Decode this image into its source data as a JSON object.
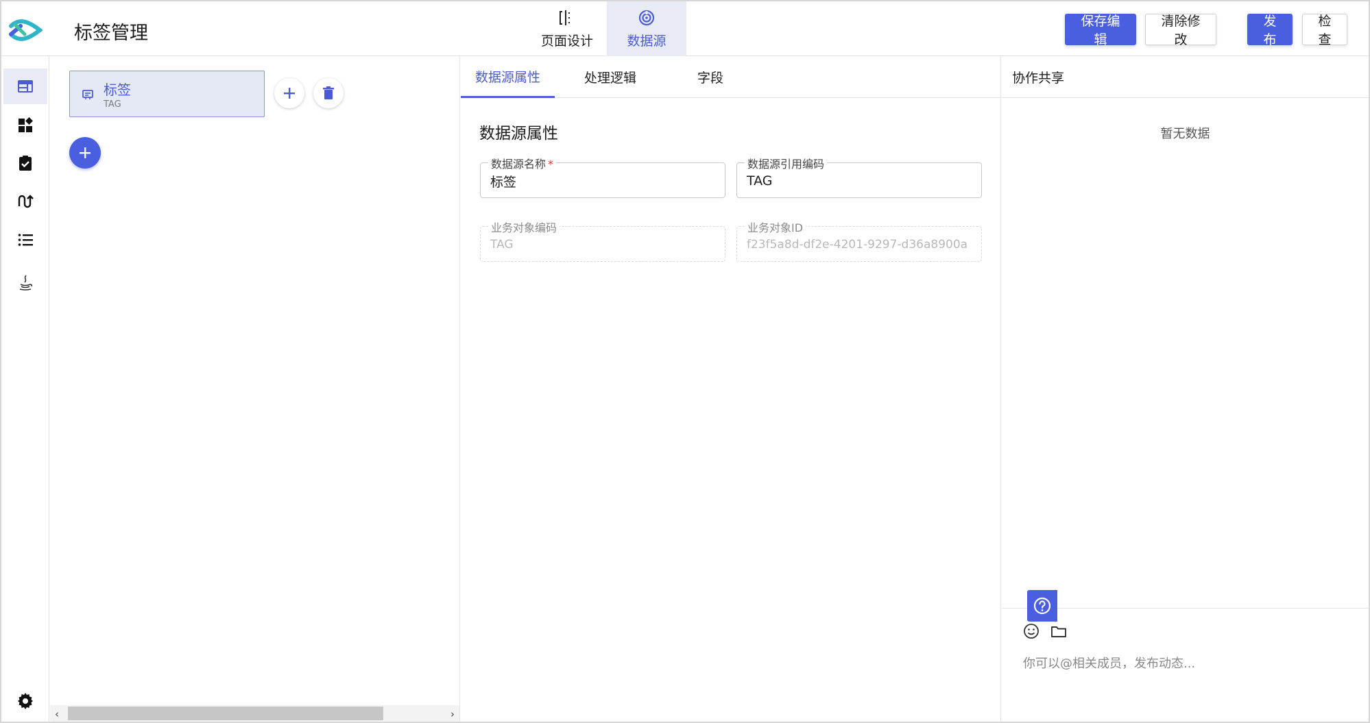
{
  "app": {
    "title": "标签管理",
    "accent_color": "#4a5fe0"
  },
  "mode_tabs": [
    {
      "label": "页面设计",
      "icon": "split-columns-icon",
      "active": false
    },
    {
      "label": "数据源",
      "icon": "target-icon",
      "active": true
    }
  ],
  "toolbar": {
    "save_label": "保存编辑",
    "clear_label": "清除修改",
    "publish_label": "发布",
    "check_label": "检查"
  },
  "rail": {
    "items": [
      {
        "icon": "web-layout-icon",
        "active": true
      },
      {
        "icon": "widgets-icon",
        "active": false
      },
      {
        "icon": "clipboard-check-icon",
        "active": false
      },
      {
        "icon": "flow-icon",
        "active": false
      },
      {
        "icon": "list-icon",
        "active": false
      },
      {
        "icon": "java-icon",
        "active": false
      }
    ],
    "bottom_icon": "gear-icon"
  },
  "datasource_list": {
    "items": [
      {
        "name": "标签",
        "code": "TAG",
        "selected": true
      }
    ]
  },
  "detail": {
    "tabs": [
      {
        "label": "数据源属性",
        "active": true
      },
      {
        "label": "处理逻辑",
        "active": false
      },
      {
        "label": "字段",
        "active": false
      }
    ],
    "section_title": "数据源属性",
    "fields": {
      "name": {
        "label": "数据源名称",
        "required_mark": "*",
        "value": "标签"
      },
      "ref_code": {
        "label": "数据源引用编码",
        "value": "TAG"
      },
      "obj_code": {
        "label": "业务对象编码",
        "value": "TAG"
      },
      "obj_id": {
        "label": "业务对象ID",
        "value": "f23f5a8d-df2e-4201-9297-d36a8900a"
      }
    }
  },
  "collab": {
    "title": "协作共享",
    "empty_text": "暂无数据",
    "composer_placeholder": "你可以@相关成员，发布动态..."
  }
}
